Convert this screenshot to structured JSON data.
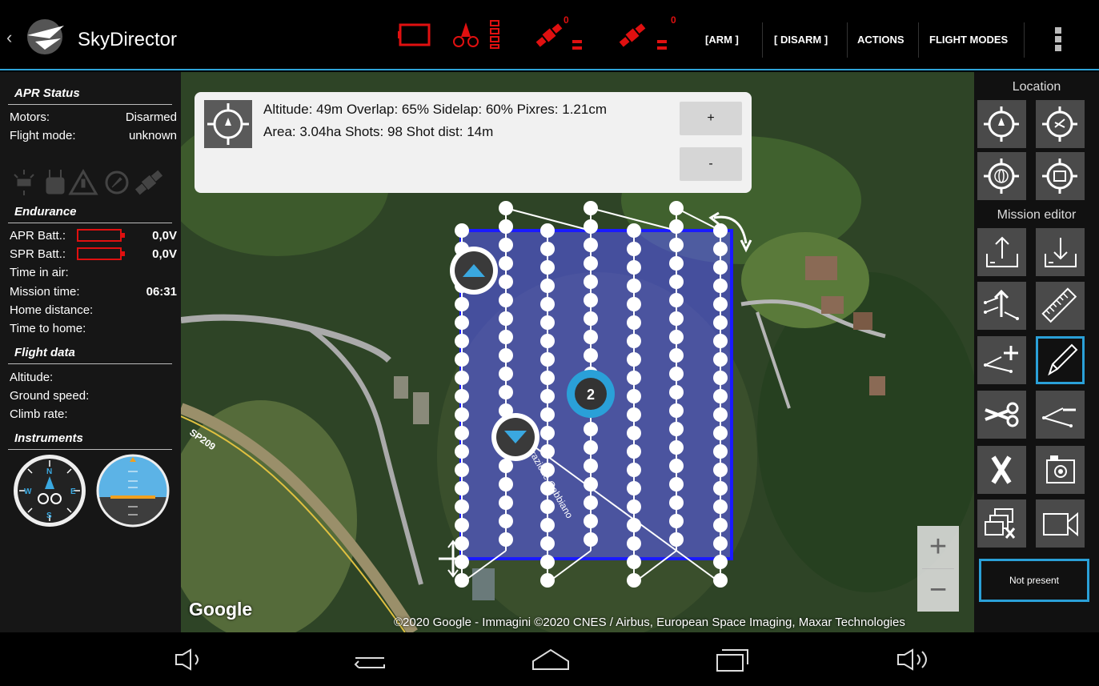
{
  "app": {
    "title": "SkyDirector"
  },
  "topbar": {
    "icons": [
      "battery-outline-icon",
      "drone-icon",
      "signal-bars-icon",
      "satellite-icon",
      "satellite-icon"
    ],
    "sat1_count": "0",
    "sat2_count": "0",
    "buttons": [
      "[ARM ]",
      "[ DISARM ]",
      "ACTIONS",
      "FLIGHT MODES"
    ]
  },
  "left": {
    "apr_status": "APR Status",
    "motors_label": "Motors:",
    "motors_value": "Disarmed",
    "flightmode_label": "Flight mode:",
    "flightmode_value": "unknown",
    "endurance": "Endurance",
    "apr_batt_label": "APR Batt.:",
    "apr_batt_value": "0,0V",
    "spr_batt_label": "SPR Batt.:",
    "spr_batt_value": "0,0V",
    "time_in_air_label": "Time in air:",
    "mission_time_label": "Mission time:",
    "mission_time_value": "06:31",
    "home_distance_label": "Home distance:",
    "time_to_home_label": "Time to home:",
    "flight_data": "Flight data",
    "altitude_label": "Altitude:",
    "ground_speed_label": "Ground speed:",
    "climb_rate_label": "Climb rate:",
    "instruments": "Instruments"
  },
  "mission_info": {
    "line1": "Altitude: 49m Overlap: 65% Sidelap: 60% Pixres: 1.21cm",
    "line2": "Area: 3.04ha Shots: 98 Shot dist: 14m",
    "plus": "+",
    "minus": "-"
  },
  "map": {
    "road_label": "SP209",
    "street_label": "Frazione Gabbiano",
    "marker_number": "2",
    "google": "Google",
    "copyright": "©2020 Google - Immagini ©2020 CNES / Airbus, European Space Imaging, Maxar Technologies",
    "zoom_in": "+",
    "zoom_out": "−"
  },
  "right": {
    "location_title": "Location",
    "mission_editor_title": "Mission editor",
    "not_present": "Not present"
  },
  "colors": {
    "accent": "#2fa4d8",
    "alert": "#e01010",
    "polygon": "#1a1aff"
  }
}
